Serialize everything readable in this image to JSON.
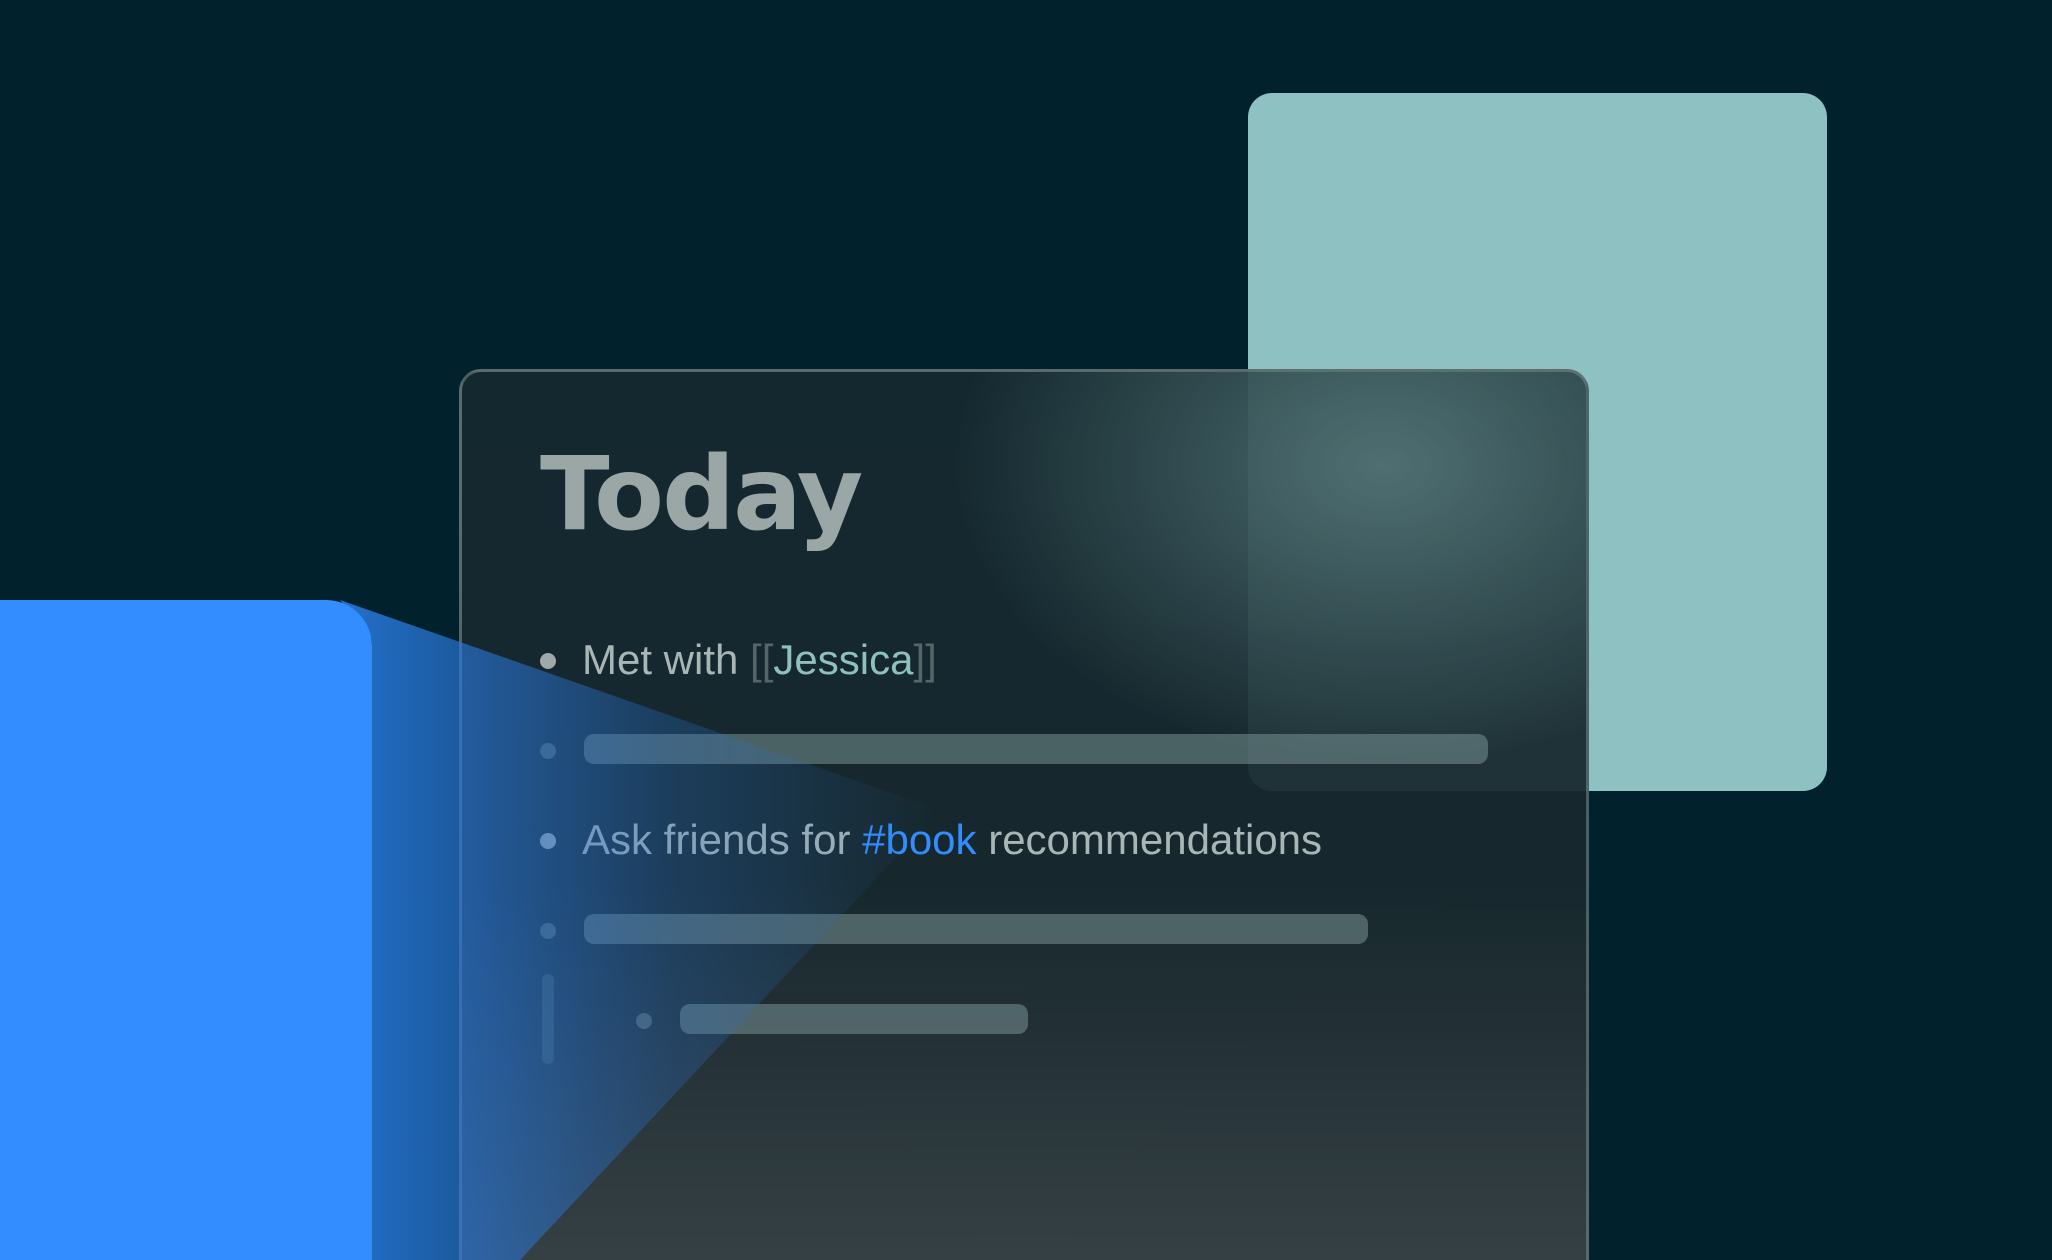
{
  "note": {
    "title": "Today",
    "items": [
      {
        "prefix": "Met with ",
        "link_open": "[[",
        "link_name": "Jessica",
        "link_close": "]]"
      },
      {
        "prefix": "Ask friends for ",
        "tag": "#book",
        "suffix": " recommendations"
      }
    ]
  },
  "colors": {
    "background": "#01222c",
    "teal_card": "#8ec1c1",
    "blue_card": "#338dfe",
    "link": "#8fc0bf",
    "tag": "#338dfe",
    "title": "#9aa7a6"
  }
}
